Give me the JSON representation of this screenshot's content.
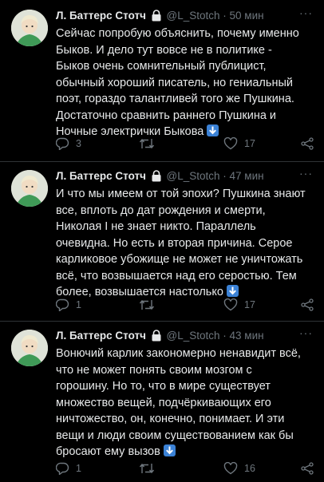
{
  "tweets": [
    {
      "author_name": "Л. Баттерс Стотч",
      "handle": "@L_Stotch",
      "separator": "·",
      "time": "50 мин",
      "more": "···",
      "text": "Сейчас попробую объяснить, почему именно\nБыков. И дело тут вовсе не в политике -\nБыков очень сомнительный публицист,\nобычный хороший писатель, но гениальный\nпоэт, гораздо талантливей того же Пушкина.\nДостаточно сравнить раннего Пушкина и\nНочные электрички Быкова",
      "replies": "3",
      "retweets": "",
      "likes": "17",
      "share": ""
    },
    {
      "author_name": "Л. Баттерс Стотч",
      "handle": "@L_Stotch",
      "separator": "·",
      "time": "47 мин",
      "more": "···",
      "text": "И что мы имеем от той эпохи? Пушкина знают\nвсе, вплоть до дат рождения и смерти,\nНиколая I не знает никто. Параллель\nочевидна. Но есть и вторая причина. Серое\nкарликовое убожище не может не уничтожать\nвсё, что возвышается над его серостью. Тем\nболее, возвышается настолько",
      "replies": "1",
      "retweets": "",
      "likes": "17",
      "share": ""
    },
    {
      "author_name": "Л. Баттерс Стотч",
      "handle": "@L_Stotch",
      "separator": "·",
      "time": "43 мин",
      "more": "···",
      "text": "Вонючий карлик закономерно ненавидит всё,\nчто не может понять своим мозгом с\nгорошину. Но то, что в мире существует\nмножество вещей, подчёркивающих его\nничтожество, он, конечно, понимает. И эти\nвещи и люди своим существованием как бы\nбросают ему вызов",
      "replies": "1",
      "retweets": "",
      "likes": "16",
      "share": ""
    }
  ],
  "icons": {
    "lock": "lock-icon",
    "arrow": "down-arrow-emoji-icon",
    "reply": "reply-icon",
    "retweet": "retweet-icon",
    "like": "heart-icon",
    "share": "share-icon"
  },
  "colors": {
    "background": "#000000",
    "text": "#e7e9ea",
    "muted": "#6e767d",
    "arrow_emoji": "#3b82d6"
  }
}
